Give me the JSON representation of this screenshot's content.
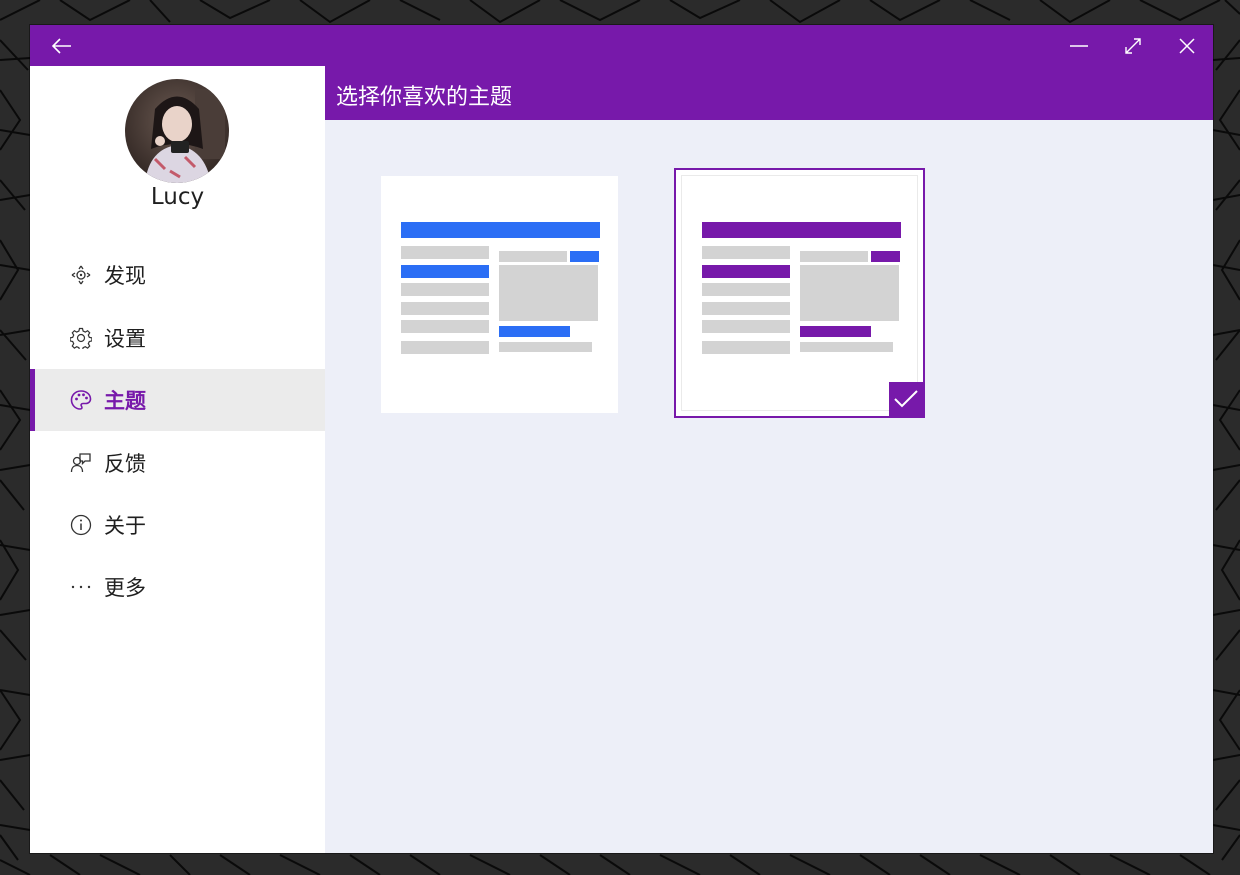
{
  "window": {
    "back_icon": "back-arrow-icon",
    "minimize_icon": "minimize-icon",
    "maximize_icon": "maximize-icon",
    "close_icon": "close-icon",
    "accent": "#7719aa"
  },
  "profile": {
    "name": "Lucy"
  },
  "nav": {
    "items": [
      {
        "label": "发现",
        "icon": "discover-icon",
        "active": false
      },
      {
        "label": "设置",
        "icon": "gear-icon",
        "active": false
      },
      {
        "label": "主题",
        "icon": "palette-icon",
        "active": true
      },
      {
        "label": "反馈",
        "icon": "feedback-icon",
        "active": false
      },
      {
        "label": "关于",
        "icon": "info-icon",
        "active": false
      },
      {
        "label": "更多",
        "icon": "more-icon",
        "active": false
      }
    ]
  },
  "main": {
    "title": "选择你喜欢的主题",
    "themes": [
      {
        "name": "blue",
        "color": "#2b6ef5",
        "selected": false
      },
      {
        "name": "purple",
        "color": "#7719aa",
        "selected": true
      }
    ]
  }
}
